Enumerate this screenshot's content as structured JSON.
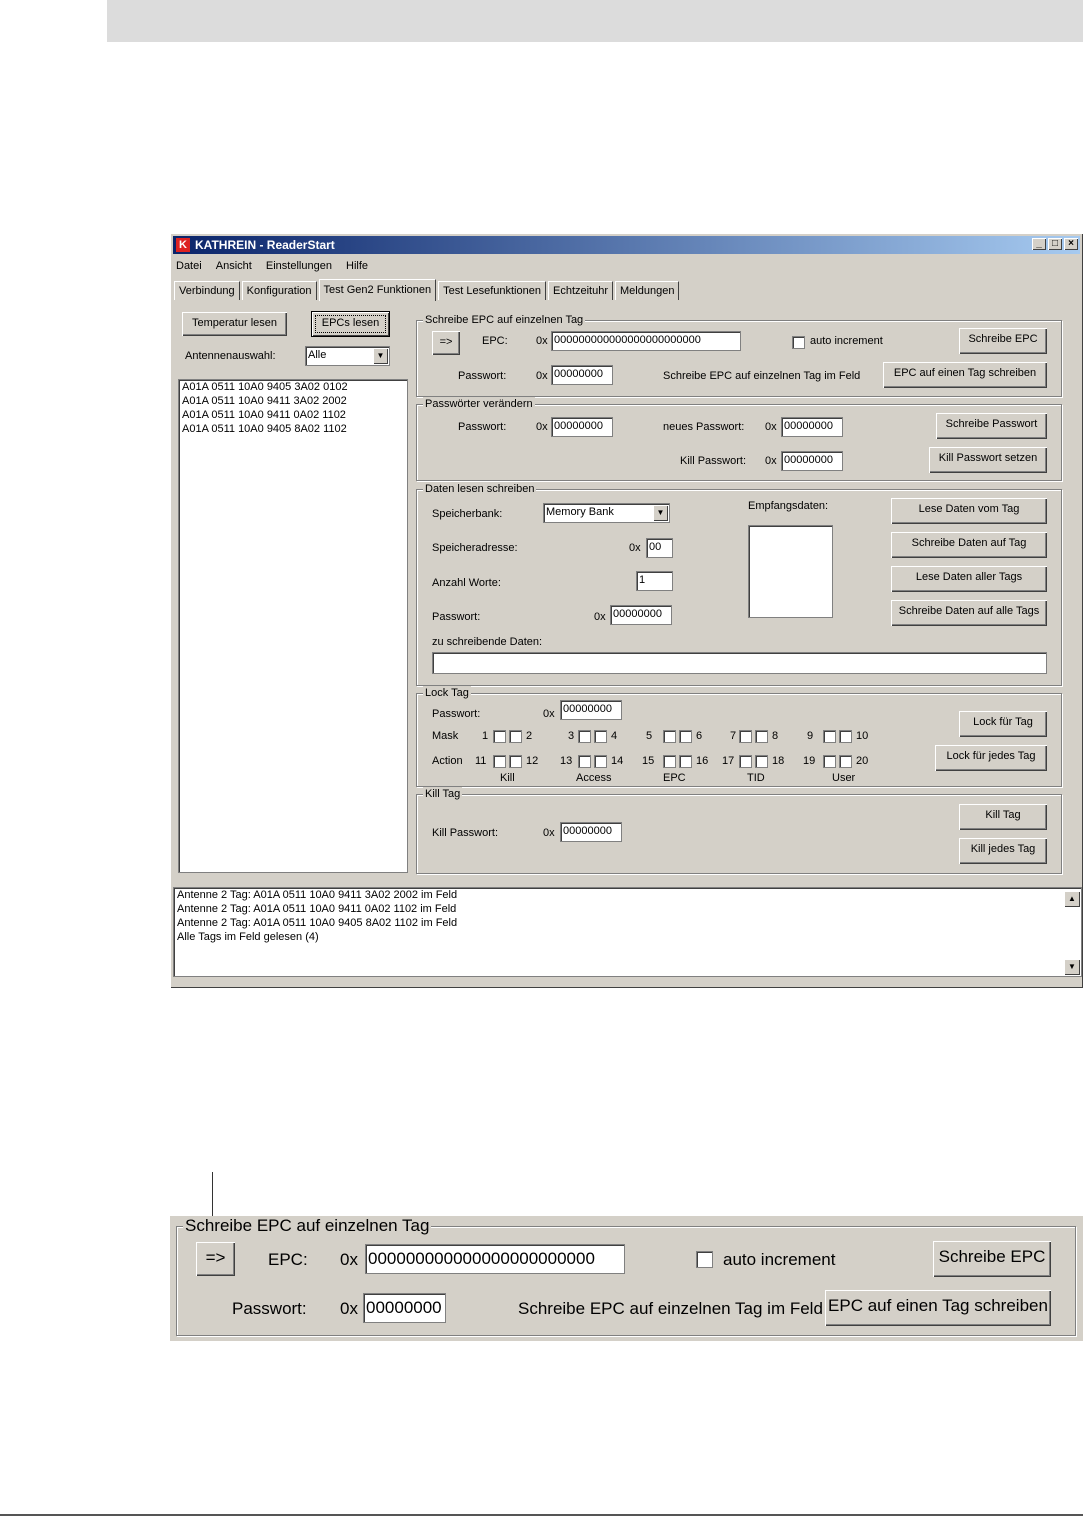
{
  "window": {
    "title": "KATHREIN - ReaderStart",
    "logo": "K",
    "minimize": "_",
    "maximize": "□",
    "close": "×"
  },
  "menu": [
    "Datei",
    "Ansicht",
    "Einstellungen",
    "Hilfe"
  ],
  "tabs": [
    "Verbindung",
    "Konfiguration",
    "Test Gen2 Funktionen",
    "Test Lesefunktionen",
    "Echtzeituhr",
    "Meldungen"
  ],
  "left": {
    "temp_button": "Temperatur lesen",
    "epc_button": "EPCs lesen",
    "antenna_label": "Antennenauswahl:",
    "antenna_value": "Alle",
    "epc_list": [
      "A01A 0511 10A0 9405 3A02 0102",
      "A01A 0511 10A0 9411 3A02 2002",
      "A01A 0511 10A0 9411 0A02 1102",
      "A01A 0511 10A0 9405 8A02 1102"
    ]
  },
  "write_epc": {
    "title": "Schreibe EPC auf einzelnen Tag",
    "arrow_button": "=>",
    "epc_label": "EPC:",
    "hex_prefix": "0x",
    "epc_value": "000000000000000000000000",
    "auto_increment": "auto increment",
    "write_button": "Schreibe EPC",
    "password_label": "Passwort:",
    "password_value": "00000000",
    "info_text": "Schreibe EPC auf einzelnen Tag im Feld",
    "write_one_button": "EPC auf einen Tag schreiben"
  },
  "passwords": {
    "title": "Passwörter verändern",
    "password_label": "Passwort:",
    "password_value": "00000000",
    "new_label": "neues Passwort:",
    "new_value": "00000000",
    "kill_label": "Kill Passwort:",
    "kill_value": "00000000",
    "write_button": "Schreibe Passwort",
    "kill_button": "Kill Passwort setzen"
  },
  "data": {
    "title": "Daten lesen schreiben",
    "bank_label": "Speicherbank:",
    "bank_value": "Memory Bank",
    "address_label": "Speicheradresse:",
    "address_value": "00",
    "words_label": "Anzahl Worte:",
    "words_value": "1",
    "password_label": "Passwort:",
    "password_value": "00000000",
    "write_data_label": "zu schreibende Daten:",
    "received_label": "Empfangsdaten:",
    "buttons": [
      "Lese Daten vom Tag",
      "Schreibe Daten auf Tag",
      "Lese Daten aller Tags",
      "Schreibe Daten auf alle Tags"
    ]
  },
  "lock": {
    "title": "Lock Tag",
    "password_label": "Passwort:",
    "password_value": "00000000",
    "mask_label": "Mask",
    "action_label": "Action",
    "mask_nums": [
      "1",
      "2",
      "3",
      "4",
      "5",
      "6",
      "7",
      "8",
      "9",
      "10"
    ],
    "action_nums": [
      "11",
      "12",
      "13",
      "14",
      "15",
      "16",
      "17",
      "18",
      "19",
      "20"
    ],
    "categories": [
      "Kill",
      "Access",
      "EPC",
      "TID",
      "User"
    ],
    "lock_button": "Lock für Tag",
    "lock_all_button": "Lock für jedes Tag"
  },
  "kill": {
    "title": "Kill Tag",
    "password_label": "Kill Passwort:",
    "password_value": "00000000",
    "kill_button": "Kill Tag",
    "kill_all_button": "Kill jedes Tag"
  },
  "log": [
    "Antenne 2 Tag: A01A 0511 10A0 9411 3A02 2002 im Feld",
    "Antenne 2 Tag: A01A 0511 10A0 9411 0A02 1102 im Feld",
    "Antenne 2 Tag: A01A 0511 10A0 9405 8A02 1102 im Feld",
    "Alle Tags im Feld gelesen (4)"
  ],
  "scroll": {
    "up": "▲",
    "down": "▼"
  }
}
